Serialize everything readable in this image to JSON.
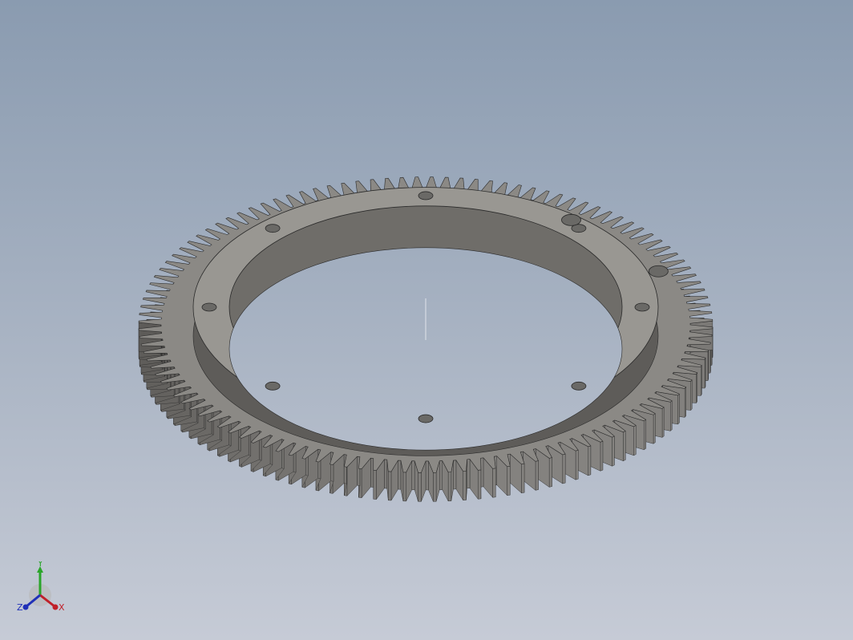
{
  "scene": {
    "object": "gear-ring",
    "tooth_count": 120,
    "bolt_hole_count": 8,
    "extra_hole_count": 2,
    "colors": {
      "background_top": "#8a9bb0",
      "background_bottom": "#c6cbd6",
      "gear_face": "#8b8985",
      "gear_side": "#5e5c59",
      "gear_dark": "#3c3b3a",
      "flange_face": "#999792",
      "bore_wall": "#6f6d69",
      "edge": "#2a2a2a"
    }
  },
  "triad": {
    "labels": {
      "x": "X",
      "y": "Y",
      "z": "Z"
    },
    "colors": {
      "x": "#c0202a",
      "y": "#2aa52a",
      "z": "#2030b8"
    }
  }
}
